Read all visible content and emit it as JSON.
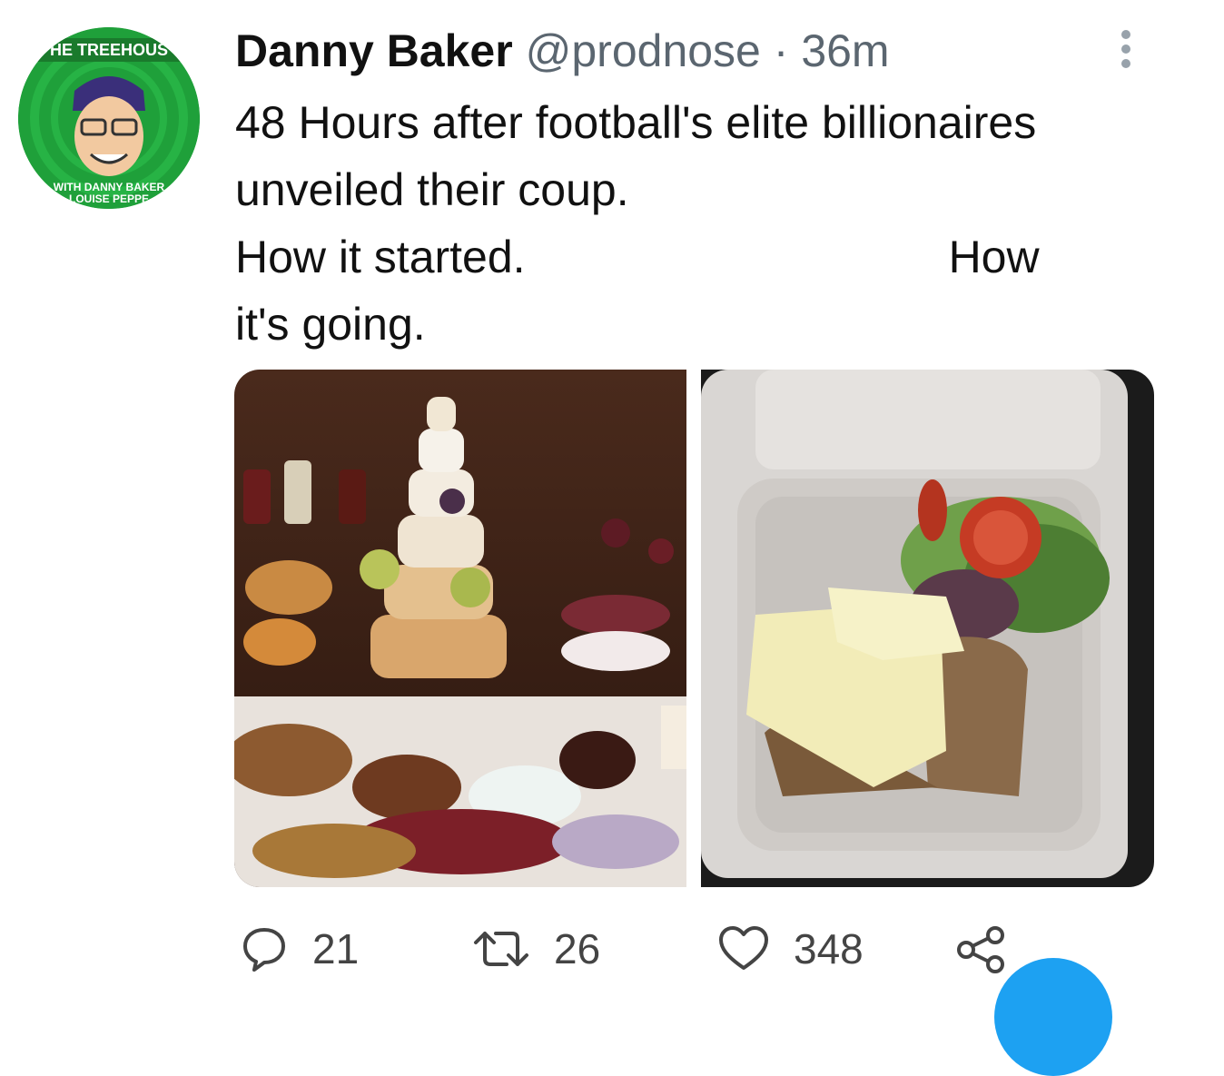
{
  "tweet": {
    "author_name": "Danny Baker",
    "handle": "@prodnose",
    "separator": " · ",
    "time": "36m",
    "text_lines": [
      "48 Hours after football's elite billionaires",
      "unveiled their coup.",
      "How it started.",
      "How",
      "it's going."
    ]
  },
  "avatar": {
    "top_text": "HE TREEHOUS",
    "bottom_text_1": "WITH DANNY BAKER",
    "bottom_text_2": "LOUISE PEPPE"
  },
  "actions": {
    "reply_count": "21",
    "retweet_count": "26",
    "like_count": "348"
  },
  "icons": [
    "more-vertical-icon",
    "reply-icon",
    "retweet-icon",
    "like-icon",
    "share-icon"
  ],
  "colors": {
    "accent": "#1da1f2",
    "meta": "#5b6670",
    "avatar_bg": "#1fa03a"
  }
}
